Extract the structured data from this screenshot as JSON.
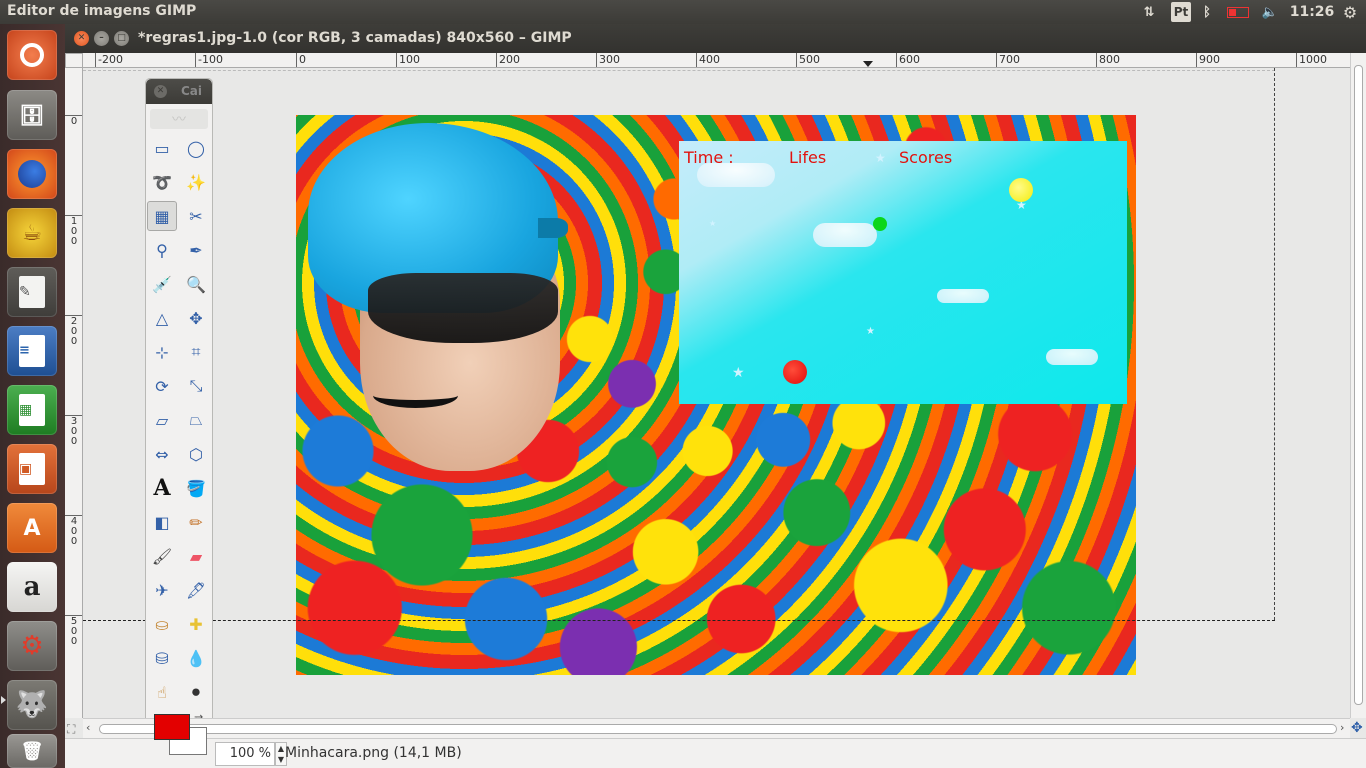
{
  "topbar": {
    "app_title": "Editor de imagens GIMP",
    "keyboard_layout": "Pt",
    "clock": "11:26",
    "indicators": [
      "network-arrows-icon",
      "keyboard-layout-icon",
      "bluetooth-icon",
      "battery-icon",
      "volume-mute-icon",
      "settings-gear-icon"
    ]
  },
  "launcher": {
    "items": [
      "ubuntu-dash-icon",
      "files-icon",
      "firefox-icon",
      "teapot-icon",
      "text-editor-icon",
      "libreoffice-writer-icon",
      "libreoffice-calc-icon",
      "libreoffice-impress-icon",
      "software-center-icon",
      "amazon-icon",
      "system-settings-icon",
      "gimp-icon",
      "trash-icon"
    ]
  },
  "window": {
    "title": "*regras1.jpg-1.0 (cor RGB, 3 camadas) 840x560 – GIMP"
  },
  "ruler_top": {
    "labels": [
      "-200",
      "-100",
      "0",
      "100",
      "200",
      "300",
      "400",
      "500",
      "600",
      "700",
      "800",
      "900",
      "1000"
    ]
  },
  "ruler_left": {
    "labels": [
      "0",
      "1\n0\n0",
      "2\n0\n0",
      "3\n0\n0",
      "4\n0\n0",
      "5\n0\n0"
    ]
  },
  "toolbox": {
    "header": "Cai",
    "tools": [
      "rect-select-icon",
      "ellipse-select-icon",
      "free-select-icon",
      "fuzzy-select-icon",
      "color-select-icon",
      "scissors-select-icon",
      "foreground-select-icon",
      "paths-icon",
      "color-picker-icon",
      "zoom-icon",
      "measure-icon",
      "move-icon",
      "align-icon",
      "crop-icon",
      "rotate-icon",
      "scale-icon",
      "shear-icon",
      "perspective-icon",
      "flip-icon",
      "cage-icon",
      "text-icon",
      "bucket-fill-icon",
      "blend-icon",
      "pencil-icon",
      "paintbrush-icon",
      "eraser-icon",
      "airbrush-icon",
      "ink-icon",
      "clone-icon",
      "heal-icon",
      "perspective-clone-icon",
      "blur-icon",
      "smudge-icon",
      "dodge-burn-icon"
    ],
    "fg_color": "#e30000",
    "bg_color": "#ffffff"
  },
  "game": {
    "time_label": "Time :",
    "lifes_label": "Lifes",
    "scores_label": "Scores"
  },
  "status": {
    "zoom": "100 %",
    "file_info": "Minhacara.png (14,1 MB)"
  }
}
